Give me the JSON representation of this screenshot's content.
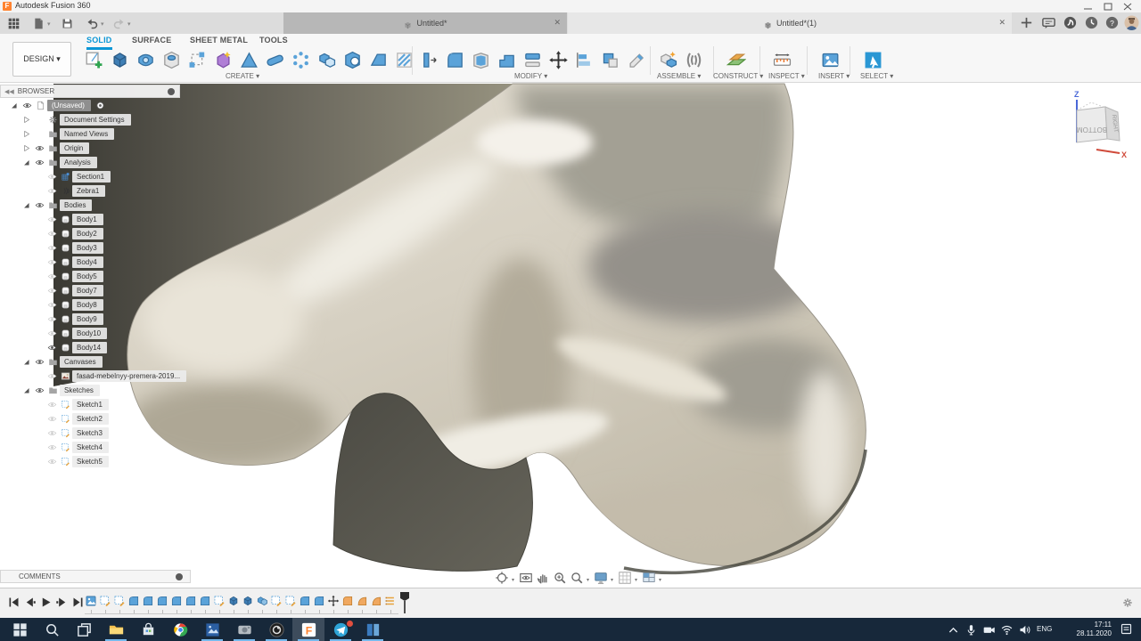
{
  "window": {
    "title": "Autodesk Fusion 360"
  },
  "colors": {
    "accent_blue": "#0a96d6",
    "fusion_orange": "#ff8330",
    "taskbar_bg": "#17283a",
    "model_beige": "#d6d0c2",
    "model_dark_face": "#57554d"
  },
  "tabs": {
    "tab1": {
      "label": "Untitled*"
    },
    "tab2": {
      "label": "Untitled*(1)"
    }
  },
  "ribbon": {
    "design_label": "DESIGN ▾",
    "tabs": [
      {
        "label": "SOLID",
        "active": true
      },
      {
        "label": "SURFACE",
        "active": false
      },
      {
        "label": "SHEET METAL",
        "active": false
      },
      {
        "label": "TOOLS",
        "active": false
      }
    ],
    "groups": [
      {
        "label": "CREATE ▾"
      },
      {
        "label": "MODIFY ▾"
      },
      {
        "label": "ASSEMBLE ▾"
      },
      {
        "label": "CONSTRUCT ▾"
      },
      {
        "label": "INSPECT ▾"
      },
      {
        "label": "INSERT ▾"
      },
      {
        "label": "SELECT ▾"
      }
    ],
    "create_tools": [
      "create-sketch",
      "extrude",
      "revolve",
      "hole",
      "rectangular-pattern",
      "create-form",
      "loft",
      "pipe",
      "circular-pattern",
      "combine-bodies",
      "split-body",
      "chamfer-block",
      "rib"
    ],
    "modify_tools": [
      "press-pull",
      "fillet",
      "shell",
      "combine-step",
      "offset-face",
      "move-copy",
      "align",
      "physical-material",
      "delete"
    ],
    "assemble_tools": [
      "new-component",
      "joint"
    ],
    "construct_tools": [
      "construct-plane"
    ],
    "inspect_tools": [
      "measure"
    ],
    "insert_tools": [
      "insert-image"
    ],
    "select_tools": [
      "select"
    ]
  },
  "browser": {
    "header": "BROWSER",
    "items": [
      {
        "label": "(Unsaved)",
        "level": 0,
        "arrow": "expanded",
        "eye": "on",
        "icon": "doc",
        "selected": true,
        "radio": true
      },
      {
        "label": "Document Settings",
        "level": 1,
        "arrow": "collapsed",
        "eye": "none",
        "icon": "gear"
      },
      {
        "label": "Named Views",
        "level": 1,
        "arrow": "collapsed",
        "eye": "none",
        "icon": "folder"
      },
      {
        "label": "Origin",
        "level": 1,
        "arrow": "collapsed",
        "eye": "on",
        "icon": "folder"
      },
      {
        "label": "Analysis",
        "level": 1,
        "arrow": "expanded",
        "eye": "on",
        "icon": "folder"
      },
      {
        "label": "Section1",
        "level": 2,
        "arrow": "none",
        "eye": "off",
        "icon": "section"
      },
      {
        "label": "Zebra1",
        "level": 2,
        "arrow": "none",
        "eye": "off",
        "icon": "zebra"
      },
      {
        "label": "Bodies",
        "level": 1,
        "arrow": "expanded",
        "eye": "on",
        "icon": "folder"
      },
      {
        "label": "Body1",
        "level": 2,
        "arrow": "none",
        "eye": "off",
        "icon": "body"
      },
      {
        "label": "Body2",
        "level": 2,
        "arrow": "none",
        "eye": "off",
        "icon": "body"
      },
      {
        "label": "Body3",
        "level": 2,
        "arrow": "none",
        "eye": "off",
        "icon": "body"
      },
      {
        "label": "Body4",
        "level": 2,
        "arrow": "none",
        "eye": "off",
        "icon": "body"
      },
      {
        "label": "Body5",
        "level": 2,
        "arrow": "none",
        "eye": "off",
        "icon": "body"
      },
      {
        "label": "Body7",
        "level": 2,
        "arrow": "none",
        "eye": "off",
        "icon": "body"
      },
      {
        "label": "Body8",
        "level": 2,
        "arrow": "none",
        "eye": "off",
        "icon": "body"
      },
      {
        "label": "Body9",
        "level": 2,
        "arrow": "none",
        "eye": "off",
        "icon": "body"
      },
      {
        "label": "Body10",
        "level": 2,
        "arrow": "none",
        "eye": "off",
        "icon": "body"
      },
      {
        "label": "Body14",
        "level": 2,
        "arrow": "none",
        "eye": "on",
        "icon": "body"
      },
      {
        "label": "Canvases",
        "level": 1,
        "arrow": "expanded",
        "eye": "on",
        "icon": "folder"
      },
      {
        "label": "fasad-mebelnyy-premera-2019...",
        "level": 2,
        "arrow": "none",
        "eye": "off",
        "icon": "image"
      },
      {
        "label": "Sketches",
        "level": 1,
        "arrow": "expanded",
        "eye": "on",
        "icon": "folder"
      },
      {
        "label": "Sketch1",
        "level": 2,
        "arrow": "none",
        "eye": "off",
        "icon": "sketch"
      },
      {
        "label": "Sketch2",
        "level": 2,
        "arrow": "none",
        "eye": "off",
        "icon": "sketch"
      },
      {
        "label": "Sketch3",
        "level": 2,
        "arrow": "none",
        "eye": "off",
        "icon": "sketch"
      },
      {
        "label": "Sketch4",
        "level": 2,
        "arrow": "none",
        "eye": "off",
        "icon": "sketch"
      },
      {
        "label": "Sketch5",
        "level": 2,
        "arrow": "none",
        "eye": "off",
        "icon": "sketch"
      }
    ]
  },
  "comments": {
    "header": "COMMENTS"
  },
  "viewcube": {
    "front_face": "BOTTOM",
    "right_face": "RIGHT",
    "axis_up": "Z",
    "axis_right": "X"
  },
  "viewport_nav": [
    {
      "name": "orbit",
      "caret": true
    },
    {
      "name": "look-at",
      "caret": false
    },
    {
      "name": "pan",
      "caret": false
    },
    {
      "name": "zoom",
      "caret": false
    },
    {
      "name": "window-zoom",
      "caret": true
    },
    {
      "name": "display-settings",
      "caret": true
    },
    {
      "name": "layout-grid",
      "caret": true
    },
    {
      "name": "viewports",
      "caret": true
    }
  ],
  "timeline": {
    "playback": [
      "go-start",
      "step-back",
      "play",
      "step-forward",
      "go-end"
    ],
    "features": [
      "canvas",
      "sketch",
      "sketch",
      "fillet",
      "fillet",
      "fillet",
      "fillet",
      "fillet",
      "fillet",
      "sketch",
      "extrude",
      "extrude",
      "combine",
      "sketch",
      "sketch",
      "fillet",
      "fillet",
      "move",
      "fillet-suppressed",
      "form-suppressed",
      "form-suppressed",
      "list-suppressed"
    ]
  },
  "taskbar": {
    "apps": [
      {
        "name": "start",
        "running": false,
        "active": false,
        "badge": false
      },
      {
        "name": "search",
        "running": false,
        "active": false,
        "badge": false
      },
      {
        "name": "task-view",
        "running": false,
        "active": false,
        "badge": false
      },
      {
        "name": "file-explorer",
        "running": true,
        "active": false,
        "badge": false
      },
      {
        "name": "store",
        "running": false,
        "active": false,
        "badge": false
      },
      {
        "name": "chrome",
        "running": false,
        "active": false,
        "badge": false
      },
      {
        "name": "photos-app",
        "running": true,
        "active": false,
        "badge": false
      },
      {
        "name": "utility-app",
        "running": true,
        "active": false,
        "badge": false
      },
      {
        "name": "obs",
        "running": true,
        "active": false,
        "badge": false
      },
      {
        "name": "fusion-360",
        "running": true,
        "active": true,
        "badge": false
      },
      {
        "name": "telegram",
        "running": true,
        "active": false,
        "badge": true
      },
      {
        "name": "panels-app",
        "running": true,
        "active": false,
        "badge": false
      }
    ],
    "tray_icons": [
      "chevron-up",
      "microphone",
      "camera",
      "wifi",
      "volume"
    ],
    "language": "ENG",
    "time": "17:11",
    "date": "28.11.2020"
  }
}
